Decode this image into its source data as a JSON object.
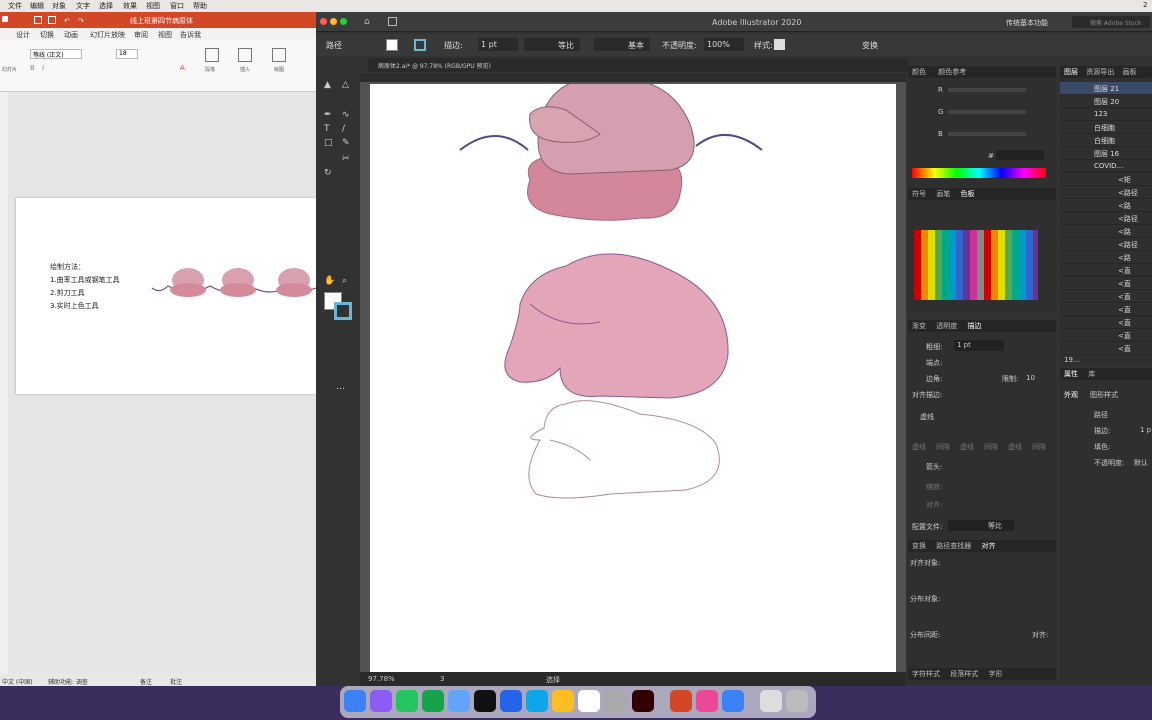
{
  "menubar": {
    "items": [
      "文件",
      "编辑",
      "对象",
      "文字",
      "选择",
      "效果",
      "视图",
      "窗口",
      "帮助"
    ],
    "right": "2"
  },
  "ppt": {
    "doc_title": "线上班第四节病原体",
    "tabs": [
      "设计",
      "切换",
      "动画",
      "幻灯片放映",
      "审阅",
      "视图",
      "告诉我"
    ],
    "font_name": "等线 (正文)",
    "font_size": "18",
    "ribbon_labels": [
      "段落",
      "插入",
      "绘图"
    ],
    "slide_lines": [
      "绘制方法：",
      "1.曲率工具或钢笔工具",
      "2.剪刀工具",
      "3.实时上色工具"
    ],
    "status": [
      "中文 (中国)",
      "辅助功能: 调查",
      "备注",
      "批注"
    ],
    "left_label": "幻灯片"
  },
  "ai": {
    "app_title": "Adobe Illustrator 2020",
    "workspace": "传统基本功能",
    "search_placeholder": "搜索 Adobe Stock",
    "doc_tab": "病原体2.ai* @ 97.78% (RGB/GPU 预览)",
    "ctrl": {
      "object": "路径",
      "stroke_label": "描边:",
      "stroke_value": "1 pt",
      "profile": "等比",
      "brush": "基本",
      "opacity_label": "不透明度:",
      "opacity_value": "100%",
      "style_label": "样式:",
      "transform": "变换"
    },
    "status": {
      "zoom": "97.78%",
      "page": "3",
      "tool": "选择"
    },
    "color_panel": {
      "tabs": [
        "颜色",
        "颜色参考"
      ],
      "channels": [
        "R",
        "G",
        "B"
      ],
      "hash": "#"
    },
    "swatches_tabs": [
      "符号",
      "画笔",
      "色板"
    ],
    "stroke_panel": {
      "tabs": [
        "渐变",
        "透明度",
        "描边"
      ],
      "weight_label": "粗细:",
      "weight_value": "1 pt",
      "cap_label": "端点:",
      "corner_label": "边角:",
      "limit_label": "限制:",
      "limit_value": "10",
      "align_label": "对齐描边:",
      "dashed": "虚线",
      "dash_labels": [
        "虚线",
        "间隙",
        "虚线",
        "间隙",
        "虚线",
        "间隙"
      ],
      "arrow_label": "箭头:",
      "scale_label": "缩放:",
      "align2_label": "对齐:",
      "profile_label": "配置文件:",
      "profile_value": "等比"
    },
    "align_panel": {
      "tabs": [
        "变换",
        "路径查找器",
        "对齐"
      ],
      "align_objects": "对齐对象:",
      "distribute_objects": "分布对象:",
      "distribute_spacing": "分布间距:",
      "align_to": "对齐:"
    },
    "char_tabs": [
      "字符样式",
      "段落样式",
      "字形"
    ],
    "layers": {
      "tabs": [
        "图层",
        "资源导出",
        "画板"
      ],
      "items": [
        "图层 21",
        "图层 20",
        "123",
        "白细胞",
        "白细胞",
        "图层 16",
        "COVID..."
      ],
      "sub": [
        "<矩",
        "<路径",
        "<路",
        "<路径",
        "<路",
        "<路径",
        "<路",
        "<直",
        "<直",
        "<直",
        "<直",
        "<直",
        "<直",
        "<直"
      ],
      "count": "19..."
    },
    "props": {
      "tabs": [
        "属性",
        "库"
      ],
      "sub_tabs": [
        "外观",
        "图形样式"
      ],
      "path": "路径",
      "stroke": "描边:",
      "stroke_val": "1 p",
      "fill": "填色:",
      "opacity": "不透明度:",
      "opacity_val": "默认"
    }
  },
  "colors": {
    "pink_dark": "#d48a9b",
    "pink": "#e0a2b3",
    "pink_light": "#d9a0b0",
    "stroke_purple": "#6a4f8f"
  }
}
